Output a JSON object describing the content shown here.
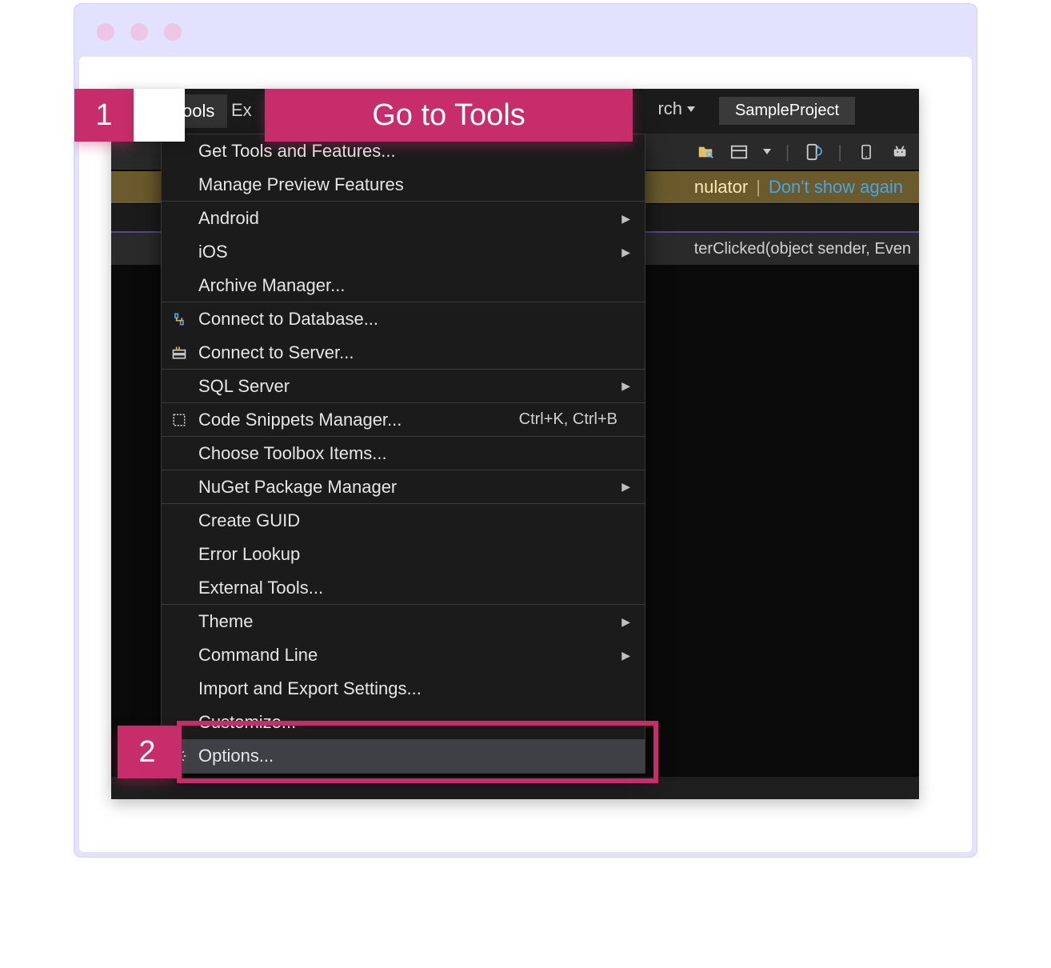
{
  "annotations": {
    "step1_num": "1",
    "step1_text": "Go to Tools",
    "step2_num": "2"
  },
  "topbar": {
    "tools_label": "Tools",
    "ex_fragment": "Ex",
    "search_fragment": "rch",
    "project_name": "SampleProject"
  },
  "notice": {
    "frag": "nulator",
    "link": "Don't show again"
  },
  "breadcrumb": {
    "frag": "terClicked(object sender, Even"
  },
  "tools_menu": {
    "items": [
      {
        "label": "Get Tools and Features...",
        "sep": false
      },
      {
        "label": "Manage Preview Features",
        "sep": true
      },
      {
        "label": "Android",
        "has_sub": true
      },
      {
        "label": "iOS",
        "has_sub": true
      },
      {
        "label": "Archive Manager...",
        "sep": true
      },
      {
        "label": "Connect to Database...",
        "icon": "plug-db"
      },
      {
        "label": "Connect to Server...",
        "icon": "plug-server",
        "sep": true
      },
      {
        "label": "SQL Server",
        "has_sub": true,
        "sep": true
      },
      {
        "label": "Code Snippets Manager...",
        "icon": "snip",
        "shortcut": "Ctrl+K, Ctrl+B",
        "sep": true
      },
      {
        "label": "Choose Toolbox Items...",
        "sep": true
      },
      {
        "label": "NuGet Package Manager",
        "has_sub": true,
        "sep": true
      },
      {
        "label": "Create GUID"
      },
      {
        "label": "Error Lookup"
      },
      {
        "label": "External Tools...",
        "sep": true
      },
      {
        "label": "Theme",
        "has_sub": true
      },
      {
        "label": "Command Line",
        "has_sub": true
      },
      {
        "label": "Import and Export Settings..."
      },
      {
        "label": "Customize..."
      },
      {
        "label": "Options...",
        "icon": "gear",
        "highlight": true
      }
    ]
  },
  "icons": {
    "folder": "folder-search-icon",
    "window": "window-icon",
    "refresh": "refresh-icon",
    "device": "device-icon",
    "android": "android-icon"
  }
}
